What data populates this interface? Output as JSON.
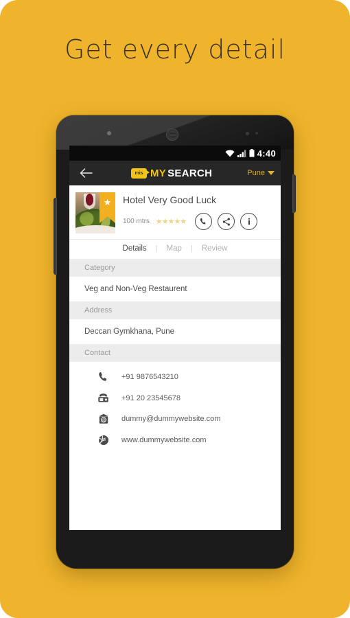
{
  "poster": {
    "headline": "Get every detail",
    "background_color": "#efb42c"
  },
  "statusbar": {
    "wifi_icon": "wifi-icon",
    "signal_icon": "signal-bars-icon",
    "battery_icon": "battery-icon",
    "time": "4:40"
  },
  "appbar": {
    "back_icon": "back-arrow-icon",
    "logo_badge_text": "mis",
    "logo_primary": "MY",
    "logo_secondary": "SEARCH",
    "city": "Pune",
    "city_caret_icon": "chevron-down-icon",
    "background_color": "#272727",
    "accent_color": "#f2c21c"
  },
  "place": {
    "thumbnail_icon": "restaurant-photo",
    "featured_badge_icon": "star-ribbon-icon",
    "name": "Hotel Very Good Luck",
    "distance": "100 mtrs",
    "rating_stars": [
      "★",
      "★",
      "★",
      "★",
      "★"
    ],
    "rating_value": 0,
    "actions": [
      {
        "name": "call-action",
        "icon": "phone-icon"
      },
      {
        "name": "share-action",
        "icon": "share-icon"
      },
      {
        "name": "info-action",
        "icon": "info-icon"
      }
    ]
  },
  "tabs": [
    {
      "label": "Details",
      "active": true
    },
    {
      "label": "Map",
      "active": false
    },
    {
      "label": "Review",
      "active": false
    }
  ],
  "tab_separator": "|",
  "sections": [
    {
      "header": "Category",
      "value": "Veg and Non-Veg Restaurent"
    },
    {
      "header": "Address",
      "value": "Deccan Gymkhana, Pune"
    },
    {
      "header": "Contact",
      "value": ""
    }
  ],
  "contacts": [
    {
      "icon": "mobile-phone-icon",
      "value": "+91 9876543210"
    },
    {
      "icon": "landline-phone-icon",
      "value": "+91 20 23545678"
    },
    {
      "icon": "email-icon",
      "value": "dummy@dummywebsite.com"
    },
    {
      "icon": "globe-icon",
      "value": "www.dummywebsite.com"
    }
  ]
}
